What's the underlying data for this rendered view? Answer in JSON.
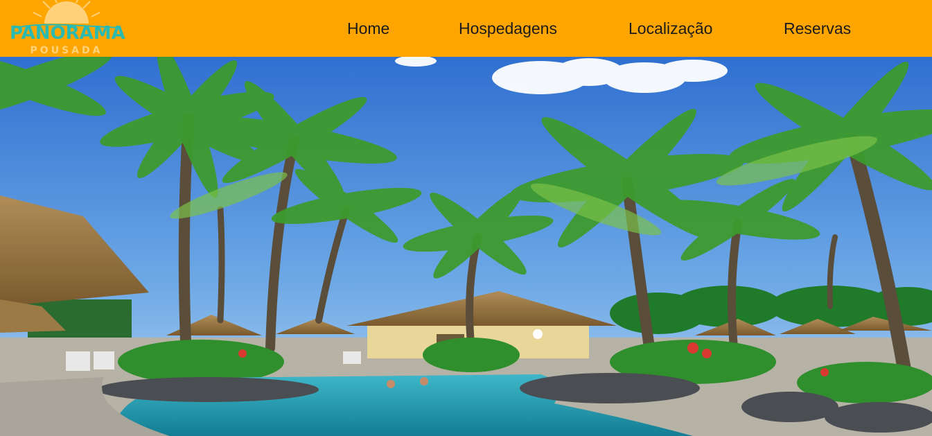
{
  "brand": {
    "name": "PANORAMA",
    "tagline": "POUSADA",
    "logo_icon": "sun-icon",
    "colors": {
      "header_bg": "#ffa500",
      "logo_text": "#2bbab1",
      "logo_sun": "#ffd27a",
      "nav_text": "#1b1b1b"
    }
  },
  "nav": {
    "items": [
      {
        "label": "Home"
      },
      {
        "label": "Hospedagens"
      },
      {
        "label": "Localização"
      },
      {
        "label": "Reservas"
      }
    ]
  },
  "hero": {
    "description_icon": "hero-photo"
  }
}
